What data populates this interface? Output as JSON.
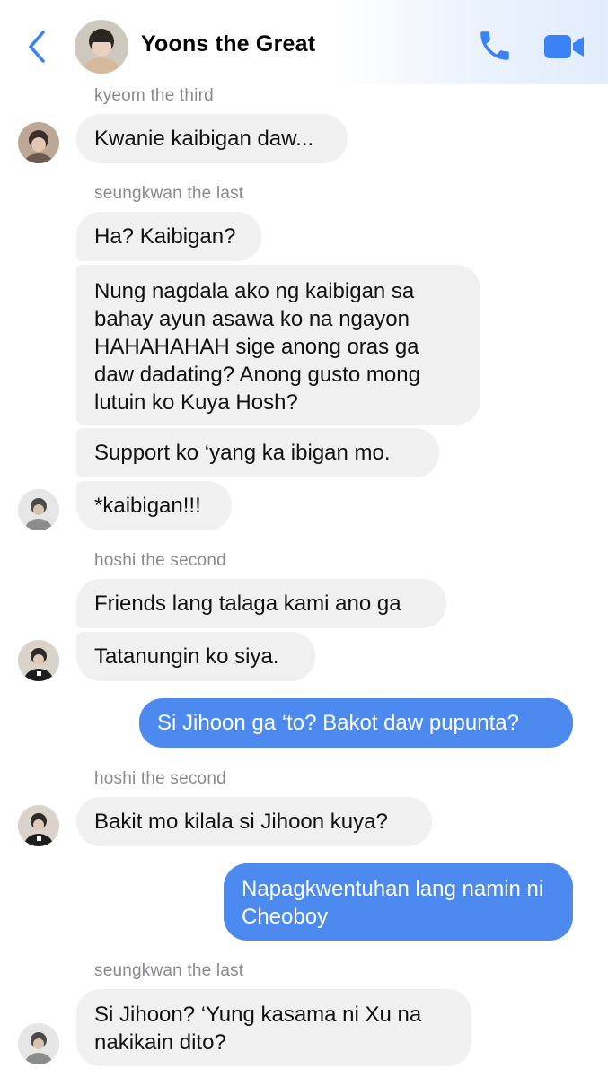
{
  "header": {
    "title": "Yoons the Great",
    "back_icon": "chevron-left-icon",
    "call_icon": "phone-icon",
    "video_icon": "video-camera-icon",
    "accent": "#3b82f6"
  },
  "messages": [
    {
      "sender": "kyeom the third"
    },
    {
      "text": "Kwanie kaibigan daw..."
    },
    {
      "sender": "seungkwan the last"
    },
    {
      "text": "Ha? Kaibigan?"
    },
    {
      "text": "Nung nagdala ako ng kaibigan sa bahay ayun asawa ko na ngayon HAHAHAHAH sige anong oras ga daw dadating? Anong gusto mong lutuin ko Kuya Hosh?"
    },
    {
      "text": "Support ko ‘yang ka ibigan mo."
    },
    {
      "text": "*kaibigan!!!"
    },
    {
      "sender": "hoshi the second"
    },
    {
      "text": "Friends lang talaga kami ano ga"
    },
    {
      "text": "Tatanungin ko siya."
    },
    {
      "text": "Si Jihoon ga ‘to? Bakot daw pupunta?"
    },
    {
      "sender": "hoshi the second"
    },
    {
      "text": "Bakit mo kilala si Jihoon kuya?"
    },
    {
      "text": "Napagkwentuhan lang namin ni Cheoboy"
    },
    {
      "sender": "seungkwan the last"
    },
    {
      "text": "Si Jihoon? ‘Yung kasama ni Xu na nakikain dito?"
    }
  ],
  "colors": {
    "incoming_bubble": "#f0f0f0",
    "outgoing_bubble": "#4d8af0",
    "sender_label": "#8a8a8e"
  }
}
